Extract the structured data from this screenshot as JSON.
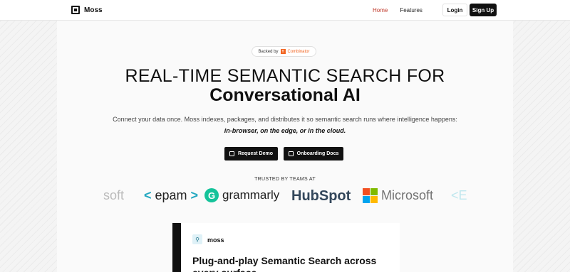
{
  "header": {
    "brand": "Moss",
    "nav": [
      {
        "label": "Home",
        "active": true
      },
      {
        "label": "Features",
        "active": false
      }
    ],
    "login_label": "Login",
    "signup_label": "Sign Up"
  },
  "hero": {
    "badge_prefix": "Backed by",
    "badge_yc_mark": "Y",
    "badge_yc_name": "Combinator",
    "title_line1": "REAL-TIME SEMANTIC SEARCH FOR",
    "title_line2": "Conversational AI",
    "subtitle_line1": "Connect your data once. Moss indexes, packages, and distributes it so semantic search runs where intelligence happens:",
    "subtitle_line2": "in-browser, on the edge, or in the cloud.",
    "cta_primary": "Request Demo",
    "cta_secondary": "Onboarding Docs"
  },
  "trusted": {
    "label": "TRUSTED BY TEAMS AT",
    "logos": [
      "soft",
      "epam",
      "grammarly",
      "HubSpot",
      "Microsoft"
    ]
  },
  "card": {
    "brand": "moss",
    "title": "Plug-and-play Semantic Search across every surface"
  },
  "colors": {
    "accent": "#111111",
    "nav_active": "#c0392b",
    "yc_orange": "#f26522",
    "grammarly_green": "#15c39a",
    "hubspot_orange": "#ff7a59"
  }
}
